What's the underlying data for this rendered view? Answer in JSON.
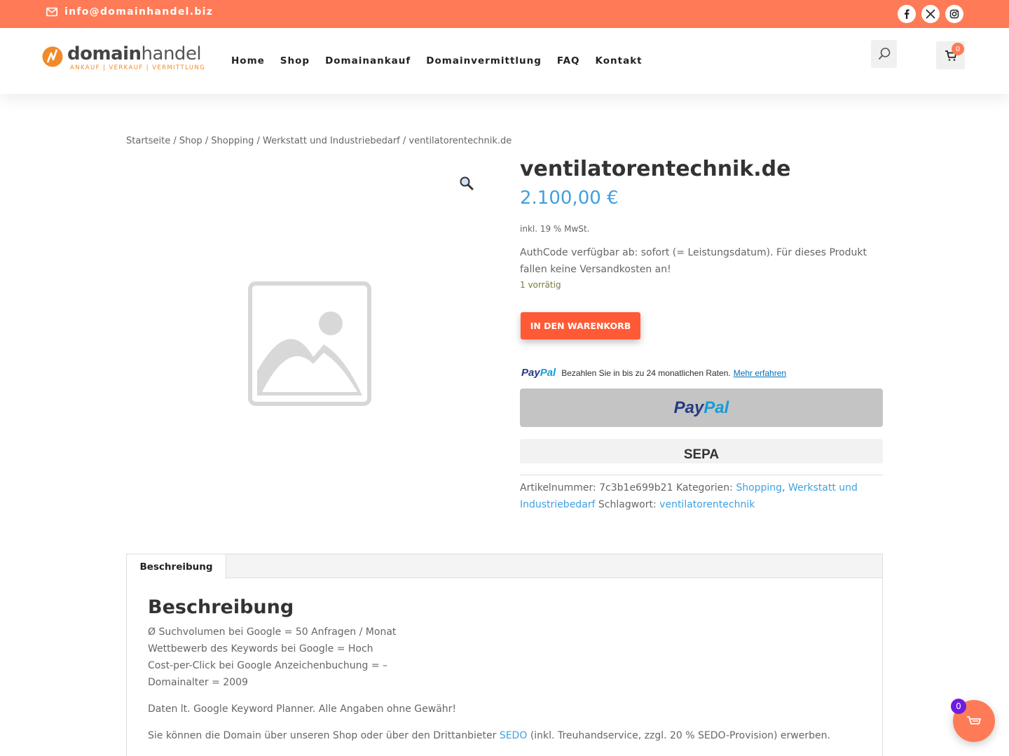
{
  "topbar": {
    "email": "info@domainhandel.biz",
    "email_icon": "envelope-icon",
    "social": [
      "facebook-icon",
      "x-icon",
      "instagram-icon"
    ]
  },
  "header": {
    "logo_word_bold": "domain",
    "logo_word_light": "handel",
    "logo_tagline": "ANKAUF | VERKAUF | VERMITTLUNG",
    "nav": [
      "Home",
      "Shop",
      "Domainankauf",
      "Domainvermittlung",
      "FAQ",
      "Kontakt"
    ],
    "search_icon": "search-icon",
    "cart_icon": "cart-icon",
    "cart_count": "0"
  },
  "breadcrumb": {
    "items": [
      "Startseite",
      "Shop",
      "Shopping",
      "Werkstatt und Industriebedarf"
    ],
    "current": "ventilatorentechnik.de",
    "separator": " / "
  },
  "product": {
    "title": "ventilatorentechnik.de",
    "price": "2.100,00 €",
    "tax_note": "inkl. 19 % MwSt.",
    "authcode_note": "AuthCode verfügbar ab: sofort (= Leistungsdatum). Für dieses Produkt fallen keine Versandkosten an!",
    "stock": "1 vorrätig",
    "add_to_cart": "IN DEN WARENKORB",
    "zoom_icon": "magnifier-icon",
    "image_placeholder_icon": "image-placeholder-icon"
  },
  "paypal": {
    "logo_pay": "Pay",
    "logo_pal": "Pal",
    "message": "Bezahlen Sie in bis zu 24 monatlichen Raten.",
    "learn_more": "Mehr erfahren",
    "button_label_pay": "Pay",
    "button_label_pal": "Pal",
    "sepa_label": "SEPA"
  },
  "meta": {
    "sku_label": "Artikelnummer:",
    "sku": "7c3b1e699b21",
    "categories_label": "Kategorien:",
    "categories": [
      "Shopping",
      "Werkstatt und Industriebedarf"
    ],
    "tag_label": "Schlagwort:",
    "tag": "ventilatorentechnik"
  },
  "tabs": {
    "active": "Beschreibung",
    "heading": "Beschreibung",
    "lines": [
      "Ø Suchvolumen bei Google = 50 Anfragen / Monat",
      "Wettbewerb des Keywords bei Google = Hoch",
      "Cost-per-Click bei Google Anzeichenbuchung = –",
      "Domainalter = 2009"
    ],
    "planner_note": "Daten lt. Google Keyword Planner. Alle Angaben ohne Gewähr!",
    "sedo_before": "Sie können die Domain über unseren Shop oder über den Drittanbieter ",
    "sedo_link": "SEDO",
    "sedo_after": " (inkl. Treuhandservice, zzgl. 20 % SEDO-Provision) erwerben."
  },
  "floating_cart": {
    "count": "0",
    "icon": "basket-icon"
  },
  "colors": {
    "accent": "#ff7b57",
    "button": "#ff5a36",
    "link": "#3fa0e0",
    "badge": "#6f1ce0"
  }
}
